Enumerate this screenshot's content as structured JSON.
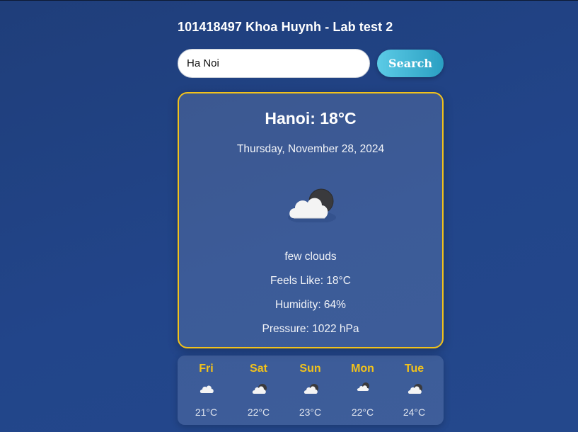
{
  "header": {
    "title": "101418497 Khoa Huynh - Lab test 2"
  },
  "search": {
    "value": "Ha Noi",
    "button_label": "Search"
  },
  "current": {
    "heading": "Hanoi: 18°C",
    "date": "Thursday, November 28, 2024",
    "icon": "few-clouds-night-icon",
    "description": "few clouds",
    "feels_like": "Feels Like: 18°C",
    "humidity": "Humidity: 64%",
    "pressure": "Pressure: 1022 hPa"
  },
  "forecast": [
    {
      "day": "Fri",
      "temp": "21°C",
      "icon": "cloud-icon"
    },
    {
      "day": "Sat",
      "temp": "22°C",
      "icon": "few-clouds-night-icon"
    },
    {
      "day": "Sun",
      "temp": "23°C",
      "icon": "few-clouds-night-icon"
    },
    {
      "day": "Mon",
      "temp": "22°C",
      "icon": "few-clouds-night-icon"
    },
    {
      "day": "Tue",
      "temp": "24°C",
      "icon": "few-clouds-night-icon"
    }
  ],
  "colors": {
    "background": "#22458a",
    "card_border": "#f2c21b",
    "day_label": "#f2c21b",
    "button_gradient_start": "#5ccbe6",
    "button_gradient_end": "#2a9fc2"
  }
}
